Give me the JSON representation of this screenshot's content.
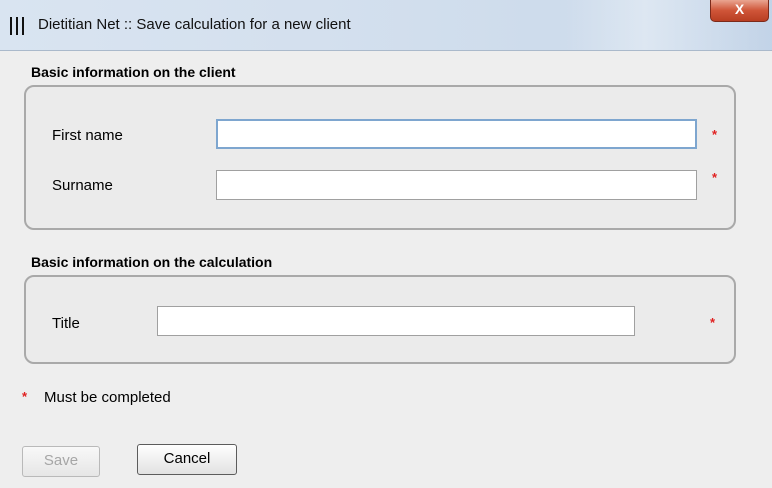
{
  "window": {
    "title": "Dietitian Net :: Save calculation for a new client",
    "icon": "cutlery-icon",
    "close_label": "X"
  },
  "client_section": {
    "heading": "Basic information on the client",
    "first_name_label": "First name",
    "first_name_value": "",
    "surname_label": "Surname",
    "surname_value": ""
  },
  "calc_section": {
    "heading": "Basic information on the calculation",
    "title_label": "Title",
    "title_value": ""
  },
  "required_marker": "*",
  "required_note": "Must be completed",
  "buttons": {
    "save": "Save",
    "cancel": "Cancel"
  },
  "colors": {
    "required": "#e02020",
    "focus_border": "#7ea6cf",
    "panel_border": "#a9a9a9"
  }
}
